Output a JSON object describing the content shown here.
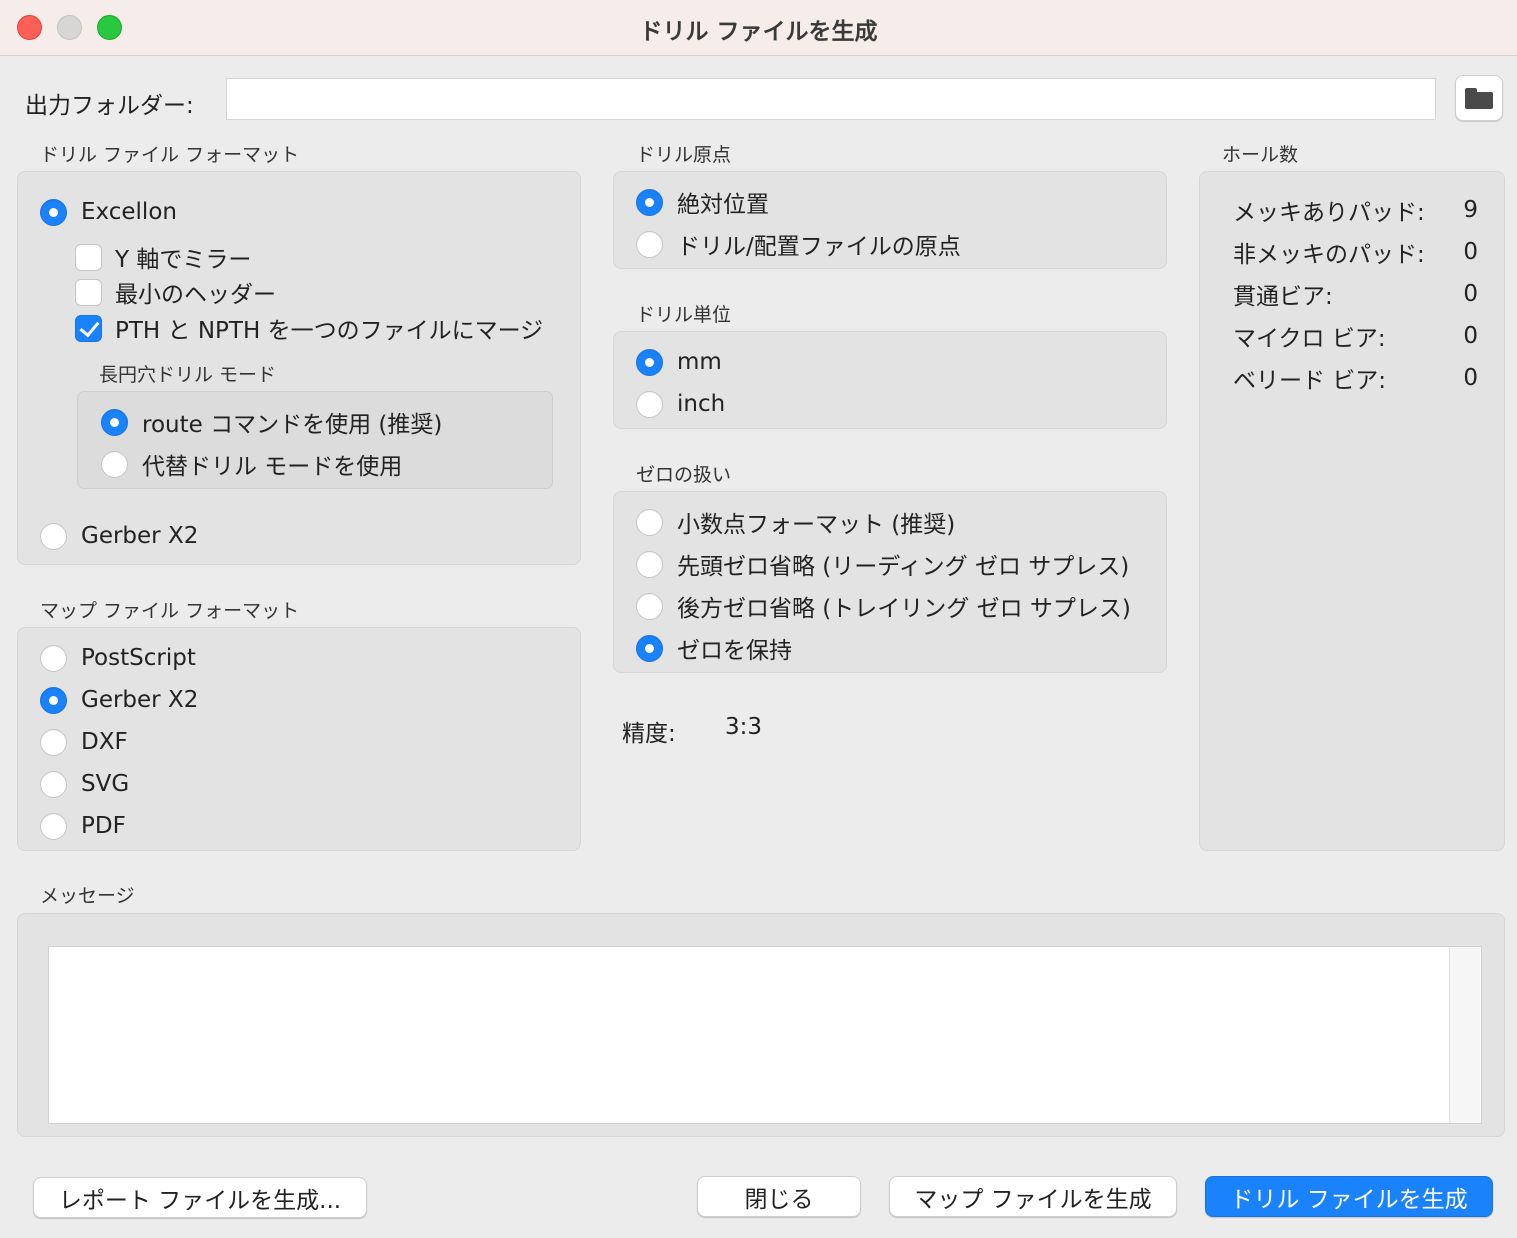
{
  "window": {
    "title": "ドリル ファイルを生成"
  },
  "output": {
    "label": "出力フォルダー:",
    "value": ""
  },
  "drill_format": {
    "title": "ドリル ファイル フォーマット",
    "excellon": "Excellon",
    "mirror_y": "Y 軸でミラー",
    "min_header": "最小のヘッダー",
    "merge_pth": "PTH と NPTH を一つのファイルにマージ",
    "oval_title": "長円穴ドリル モード",
    "route_cmd": "route コマンドを使用 (推奨)",
    "alt_mode": "代替ドリル モードを使用",
    "gerber": "Gerber X2"
  },
  "map_format": {
    "title": "マップ ファイル フォーマット",
    "options": [
      "PostScript",
      "Gerber X2",
      "DXF",
      "SVG",
      "PDF"
    ]
  },
  "drill_origin": {
    "title": "ドリル原点",
    "absolute": "絶対位置",
    "aux": "ドリル/配置ファイルの原点"
  },
  "drill_units": {
    "title": "ドリル単位",
    "mm": "mm",
    "inch": "inch"
  },
  "zeros": {
    "title": "ゼロの扱い",
    "decimal": "小数点フォーマット (推奨)",
    "suppress_leading": "先頭ゼロ省略 (リーディング ゼロ サプレス)",
    "suppress_trailing": "後方ゼロ省略 (トレイリング ゼロ サプレス)",
    "keep": "ゼロを保持"
  },
  "precision": {
    "label": "精度:",
    "value": "3:3"
  },
  "hole_counts": {
    "title": "ホール数",
    "rows": [
      {
        "label": "メッキありパッド:",
        "value": "9"
      },
      {
        "label": "非メッキのパッド:",
        "value": "0"
      },
      {
        "label": "貫通ビア:",
        "value": "0"
      },
      {
        "label": "マイクロ ビア:",
        "value": "0"
      },
      {
        "label": "ベリード ビア:",
        "value": "0"
      }
    ]
  },
  "messages": {
    "title": "メッセージ",
    "content": ""
  },
  "buttons": {
    "report": "レポート ファイルを生成...",
    "close": "閉じる",
    "map": "マップ ファイルを生成",
    "drill": "ドリル ファイルを生成"
  },
  "colors": {
    "accent": "#1a82fb",
    "titlebar": "#f6ecea",
    "window": "#ececec"
  }
}
